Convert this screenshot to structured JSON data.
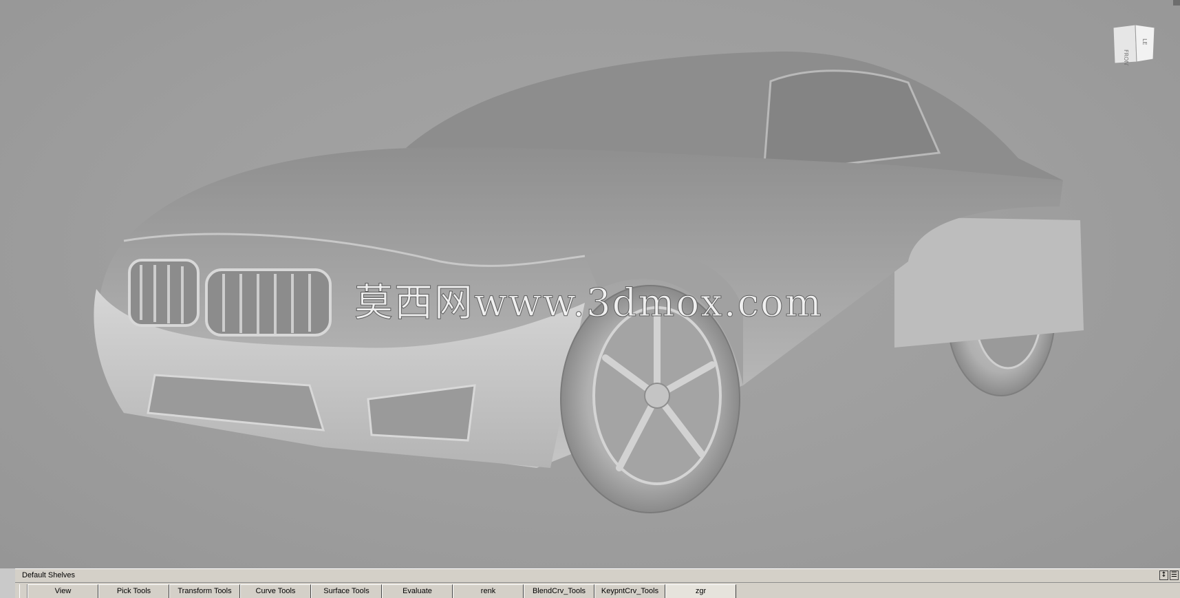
{
  "viewport": {
    "watermark": "莫西网www.3dmox.com",
    "viewcube": {
      "front_label": "FRONT",
      "side_label": "LE"
    }
  },
  "shelf": {
    "title": "Default Shelves",
    "controls": [
      "↕",
      "☰"
    ],
    "tabs": [
      {
        "label": "View"
      },
      {
        "label": "Pick Tools"
      },
      {
        "label": "Transform Tools"
      },
      {
        "label": "Curve Tools"
      },
      {
        "label": "Surface Tools"
      },
      {
        "label": "Evaluate"
      },
      {
        "label": "renk"
      },
      {
        "label": "BlendCrv_Tools"
      },
      {
        "label": "KeypntCrv_Tools"
      },
      {
        "label": "zgr"
      }
    ]
  }
}
